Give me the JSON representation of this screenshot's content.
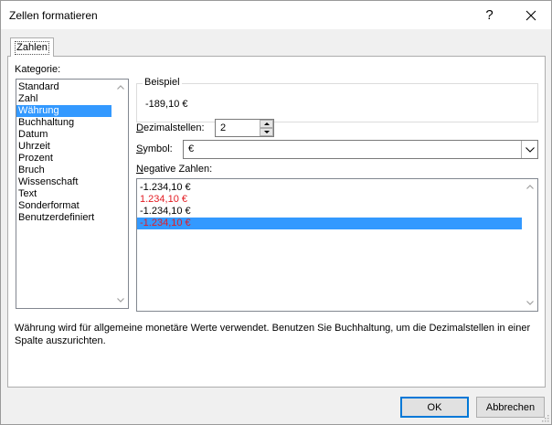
{
  "window": {
    "title": "Zellen formatieren",
    "help_glyph": "?",
    "close_icon": "close-icon"
  },
  "tabs": [
    {
      "label": "Zahlen",
      "selected": true
    }
  ],
  "category": {
    "label": "Kategorie:",
    "items": [
      "Standard",
      "Zahl",
      "Währung",
      "Buchhaltung",
      "Datum",
      "Uhrzeit",
      "Prozent",
      "Bruch",
      "Wissenschaft",
      "Text",
      "Sonderformat",
      "Benutzerdefiniert"
    ],
    "selected": "Währung"
  },
  "sample": {
    "legend": "Beispiel",
    "value": "-189,10 €"
  },
  "decimal_places": {
    "label": "Dezimalstellen:",
    "value": "2"
  },
  "symbol": {
    "label": "Symbol:",
    "value": "€"
  },
  "negative_numbers": {
    "label": "Negative Zahlen:",
    "items": [
      {
        "text": "-1.234,10 €",
        "color": "#000000"
      },
      {
        "text": "1.234,10 €",
        "color": "#e31c23"
      },
      {
        "text": "-1.234,10 €",
        "color": "#000000"
      },
      {
        "text": "-1.234,10 €",
        "color": "#e31c23"
      }
    ],
    "selected_index": 3
  },
  "description": "Währung wird für allgemeine monetäre Werte verwendet. Benutzen Sie Buchhaltung, um die Dezimalstellen in einer Spalte auszurichten.",
  "buttons": {
    "ok": "OK",
    "cancel": "Abbrechen"
  },
  "colors": {
    "selection": "#3399ff",
    "negative_red": "#e31c23"
  }
}
